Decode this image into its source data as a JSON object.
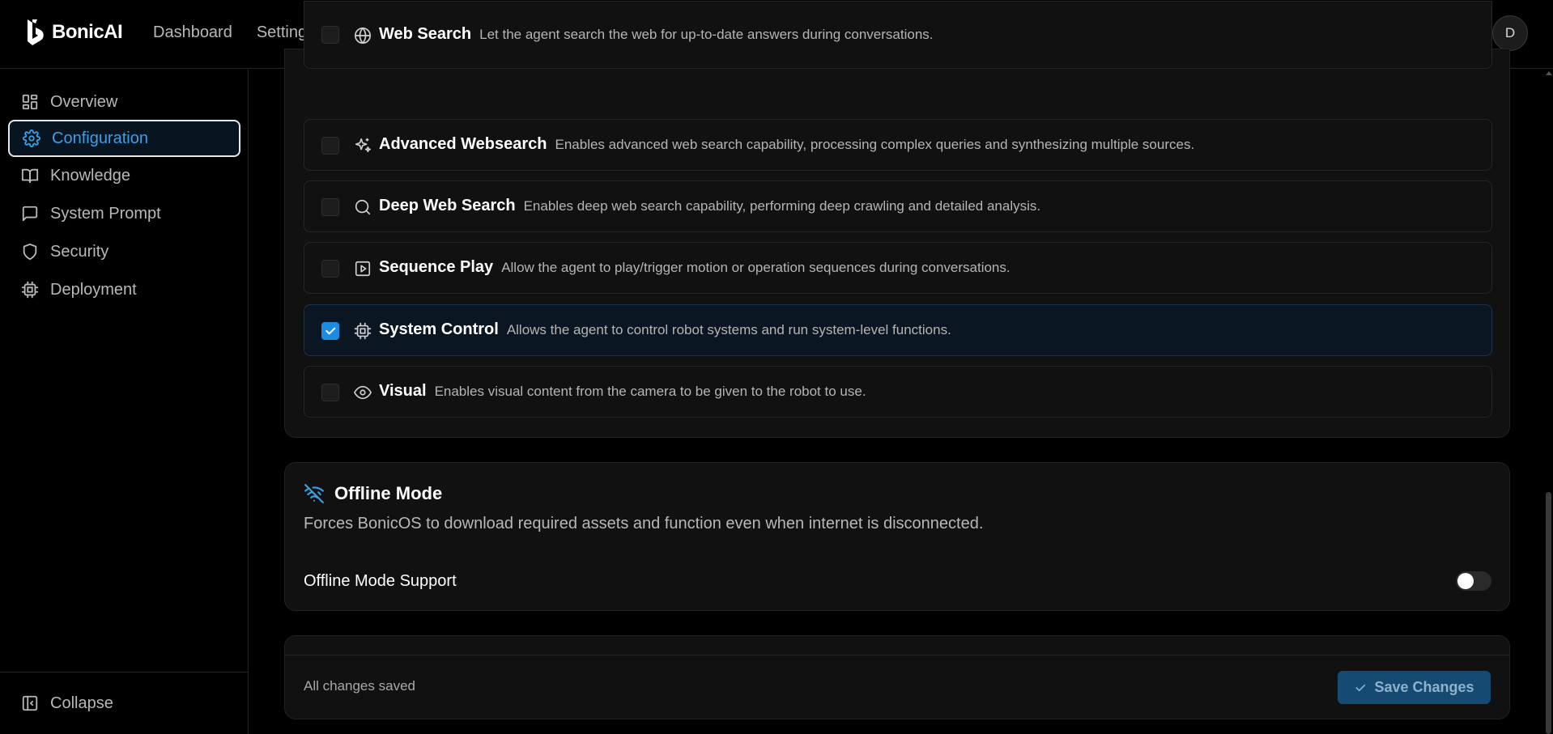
{
  "app": {
    "name": "BonicAI"
  },
  "topnav": {
    "items": [
      {
        "label": "Dashboard"
      },
      {
        "label": "Settings"
      }
    ]
  },
  "user": {
    "avatar_initial": "D"
  },
  "sidebar": {
    "items": [
      {
        "label": "Overview",
        "icon": "grid-icon"
      },
      {
        "label": "Configuration",
        "icon": "gear-icon",
        "active": true
      },
      {
        "label": "Knowledge",
        "icon": "book-icon"
      },
      {
        "label": "System Prompt",
        "icon": "message-square-icon"
      },
      {
        "label": "Security",
        "icon": "shield-icon"
      },
      {
        "label": "Deployment",
        "icon": "cpu-icon"
      }
    ],
    "collapse_label": "Collapse"
  },
  "tools": [
    {
      "name": "Web Search",
      "description": "Let the agent search the web for up-to-date answers during conversations.",
      "icon": "globe-icon",
      "checked": false
    },
    {
      "name": "Advanced Websearch",
      "description": "Enables advanced web search capability, processing complex queries and synthesizing multiple sources.",
      "icon": "sparkles-icon",
      "checked": false
    },
    {
      "name": "Deep Web Search",
      "description": "Enables deep web search capability, performing deep crawling and detailed analysis.",
      "icon": "search-icon",
      "checked": false
    },
    {
      "name": "Sequence Play",
      "description": "Allow the agent to play/trigger motion or operation sequences during conversations.",
      "icon": "play-square-icon",
      "checked": false
    },
    {
      "name": "System Control",
      "description": "Allows the agent to control robot systems and run system-level functions.",
      "icon": "cpu-icon",
      "checked": true
    },
    {
      "name": "Visual",
      "description": "Enables visual content from the camera to be given to the robot to use.",
      "icon": "eye-icon",
      "checked": false
    }
  ],
  "offline": {
    "title": "Offline Mode",
    "description": "Forces BonicOS to download required assets and function even when internet is disconnected.",
    "support_label": "Offline Mode Support",
    "enabled": false
  },
  "footer": {
    "status": "All changes saved",
    "save_label": "Save Changes"
  },
  "colors": {
    "accent": "#1d8be0",
    "active_text": "#3aa0e6",
    "background": "#000000",
    "card": "#111111"
  }
}
